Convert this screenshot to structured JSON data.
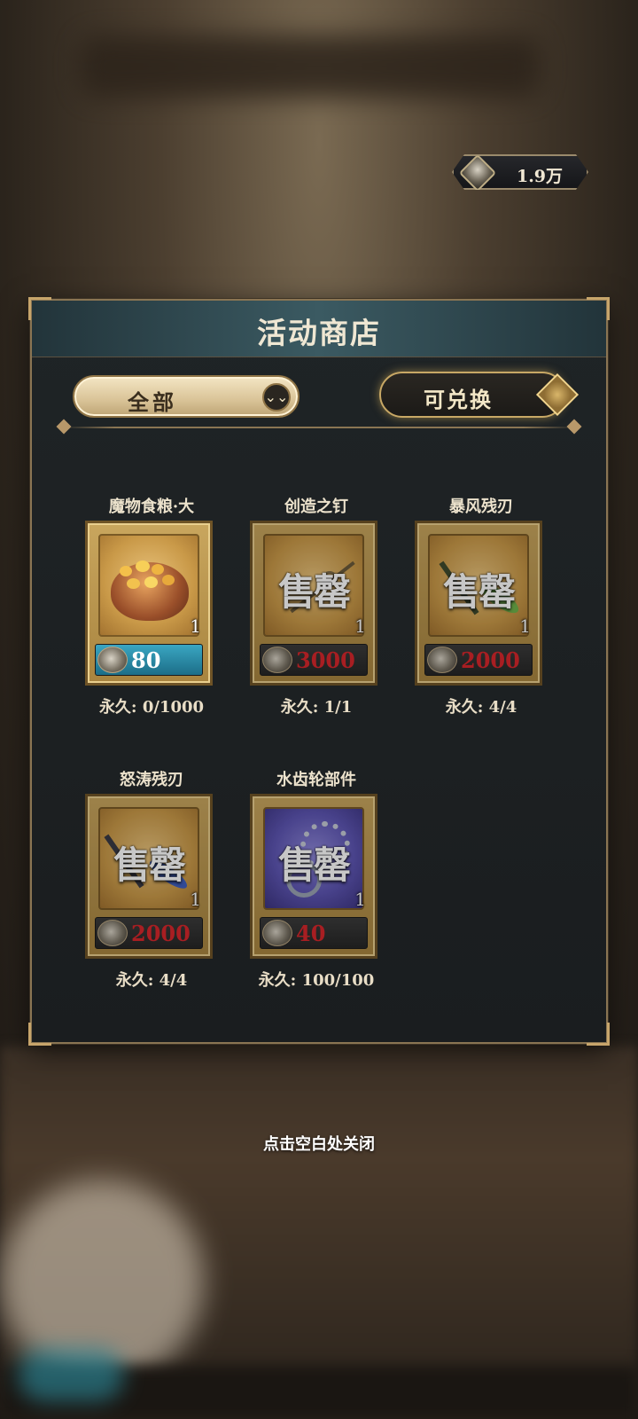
{
  "currency": {
    "icon": "currency-coin-icon",
    "value": "1.9万"
  },
  "shop": {
    "title": "活动商店",
    "filter": {
      "label": "全部",
      "icon": "chevron-double-down-icon"
    },
    "exchange": {
      "label": "可兑换",
      "toggle_state": "on"
    }
  },
  "items": [
    {
      "name": "魔物食粮·大",
      "sold_out": false,
      "sold_label": "",
      "quantity": "1",
      "price": "80",
      "price_color": "#ffffff",
      "stock": "永久: 0/1000",
      "art": "food-basket-icon"
    },
    {
      "name": "创造之钉",
      "sold_out": true,
      "sold_label": "售罄",
      "quantity": "1",
      "price": "3000",
      "price_color": "#d8272b",
      "stock": "永久: 1/1",
      "art": "nail-icon"
    },
    {
      "name": "暴风残刃",
      "sold_out": true,
      "sold_label": "售罄",
      "quantity": "1",
      "price": "2000",
      "price_color": "#d8272b",
      "stock": "永久: 4/4",
      "art": "green-blade-icon"
    },
    {
      "name": "怒涛残刃",
      "sold_out": true,
      "sold_label": "售罄",
      "quantity": "1",
      "price": "2000",
      "price_color": "#d8272b",
      "stock": "永久: 4/4",
      "art": "blue-blade-icon"
    },
    {
      "name": "水齿轮部件",
      "sold_out": true,
      "sold_label": "售罄",
      "quantity": "1",
      "price": "40",
      "price_color": "#d8272b",
      "stock": "永久: 100/100",
      "art": "water-gear-icon"
    }
  ],
  "close_hint": "点击空白处关闭"
}
